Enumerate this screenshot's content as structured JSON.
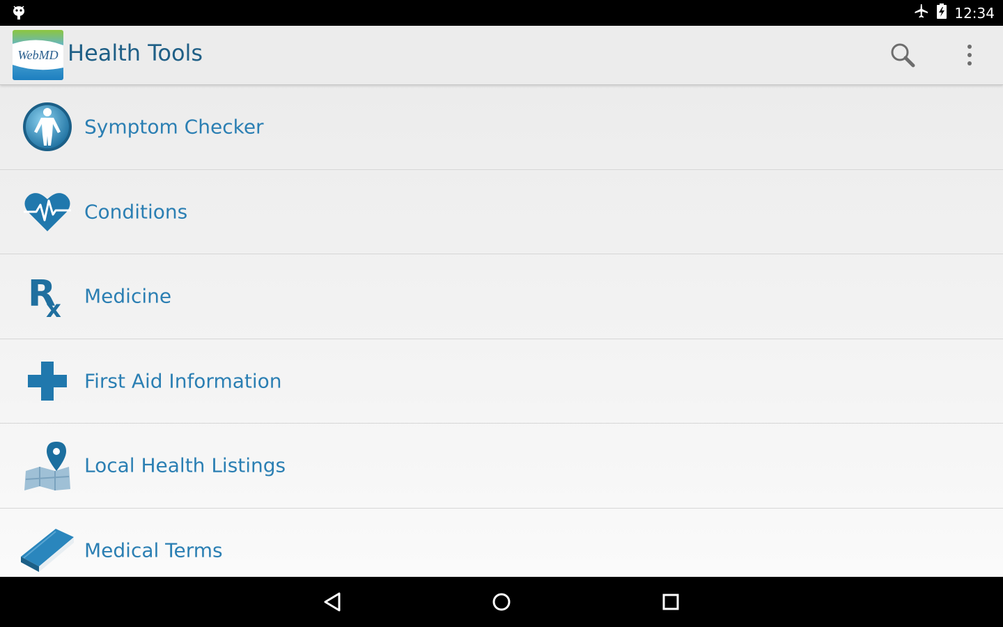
{
  "status_bar": {
    "notification_icon": "android-debug-icon",
    "airplane_icon": "airplane-icon",
    "battery_icon": "battery-charging-icon",
    "time": "12:34"
  },
  "action_bar": {
    "logo_text": "WebMD",
    "title": "Health Tools",
    "search_icon": "search-icon",
    "overflow_icon": "overflow-menu-icon"
  },
  "menu": {
    "items": [
      {
        "label": "Symptom Checker",
        "icon": "body-figure-icon"
      },
      {
        "label": "Conditions",
        "icon": "heart-pulse-icon"
      },
      {
        "label": "Medicine",
        "icon": "rx-icon"
      },
      {
        "label": "First Aid Information",
        "icon": "medical-cross-icon"
      },
      {
        "label": "Local Health Listings",
        "icon": "map-pin-icon"
      },
      {
        "label": "Medical Terms",
        "icon": "book-icon"
      }
    ]
  },
  "nav_bar": {
    "back_icon": "back-icon",
    "home_icon": "home-icon",
    "recents_icon": "recents-icon"
  },
  "colors": {
    "accent": "#2b7fb3",
    "title": "#1f5f86",
    "icon_blue": "#1f6f9f",
    "action_bar_bg": "#ececec"
  }
}
